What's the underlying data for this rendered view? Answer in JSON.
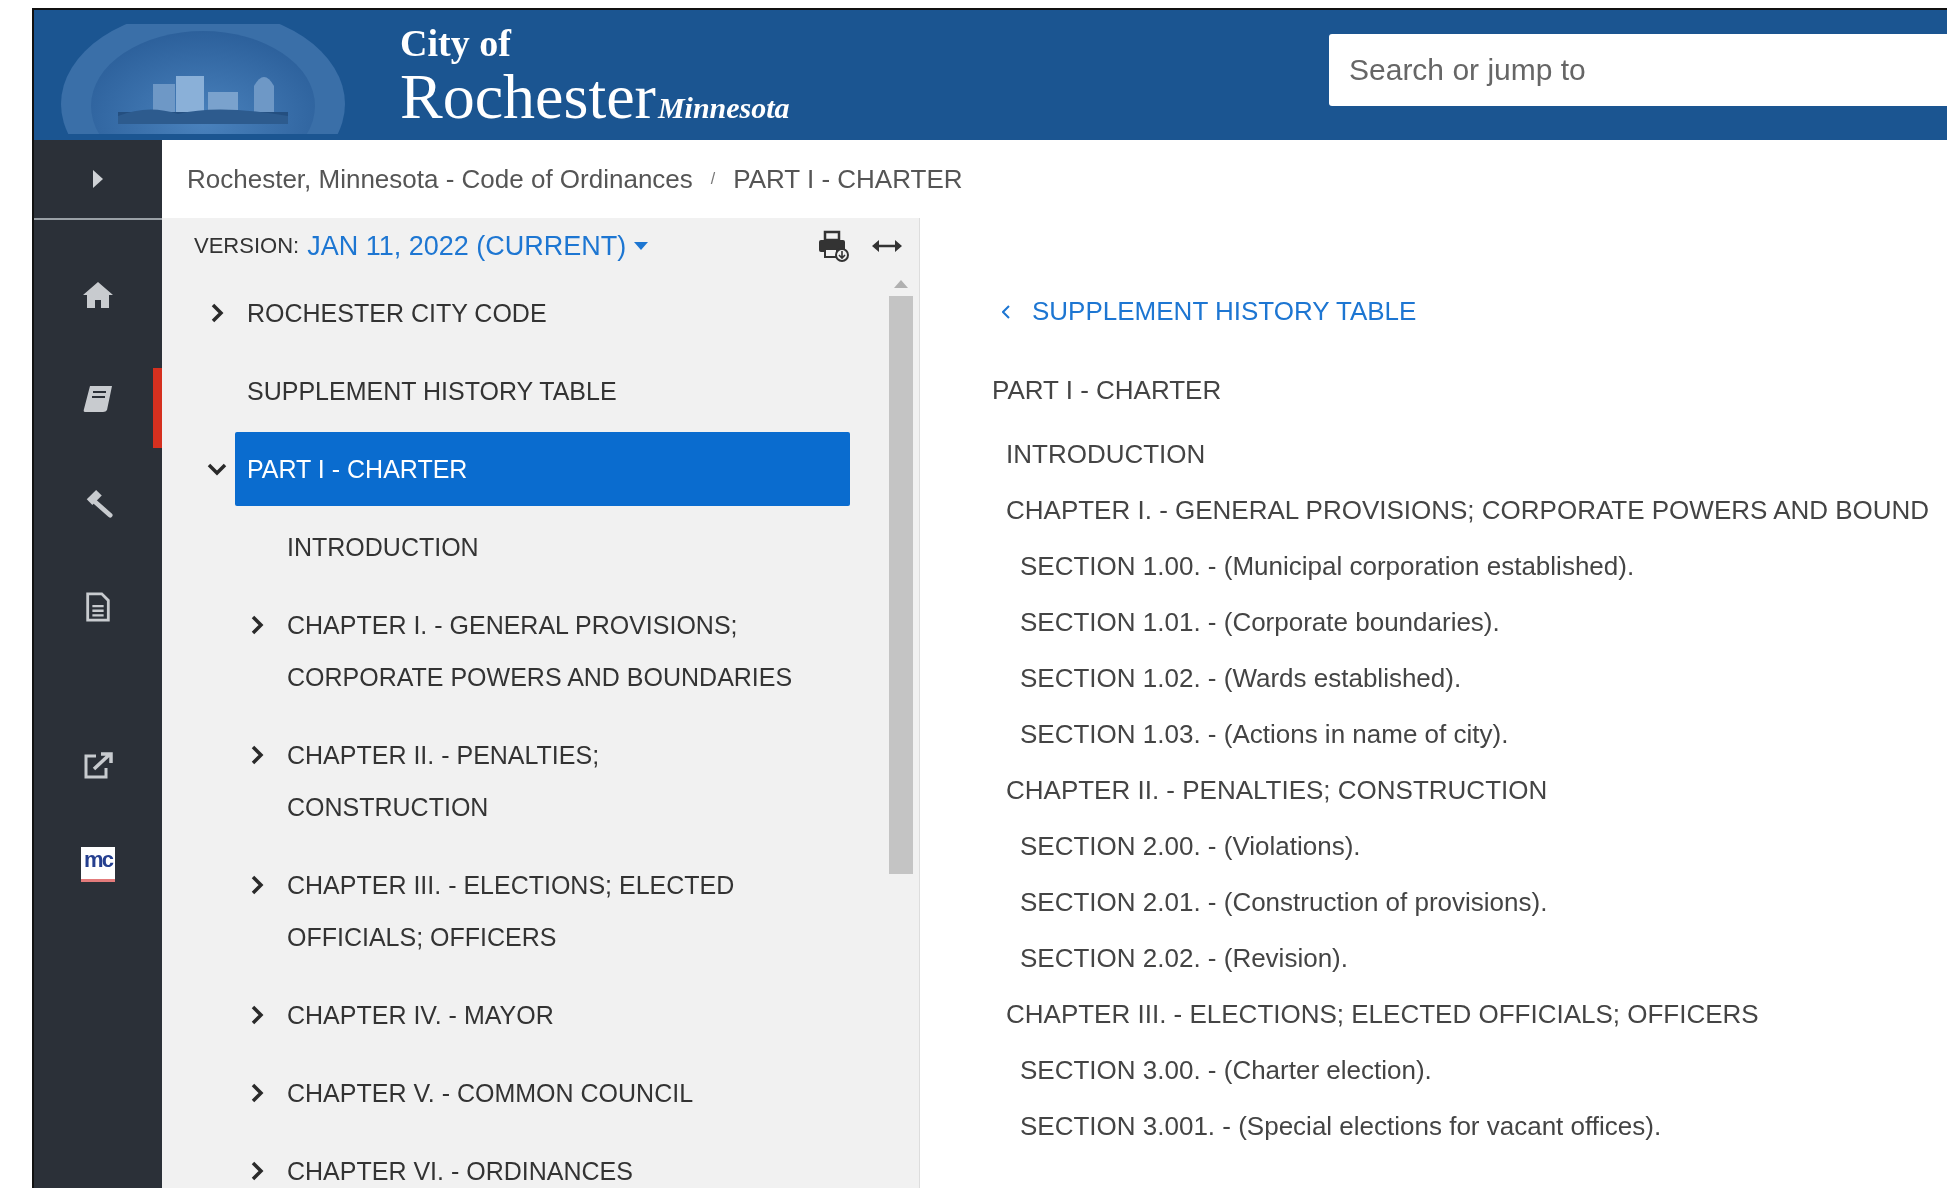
{
  "header": {
    "city_of": "City of",
    "name": "Rochester",
    "state": "Minnesota",
    "search": {
      "placeholder": "Search or jump to"
    }
  },
  "sidebar": {
    "items": [
      {
        "kind": "home",
        "selected": false
      },
      {
        "kind": "book",
        "selected": true
      },
      {
        "kind": "gavel",
        "selected": false
      },
      {
        "kind": "document",
        "selected": false
      },
      {
        "kind": "external",
        "selected": false
      },
      {
        "kind": "logo",
        "selected": false,
        "label": "mc"
      }
    ]
  },
  "breadcrumb": [
    "Rochester, Minnesota - Code of Ordinances",
    "PART I - CHARTER"
  ],
  "breadcrumb_separator": "/",
  "nav": {
    "version_label": "VERSION:",
    "version_value": "JAN 11, 2022 (CURRENT)",
    "items": [
      {
        "label": "ROCHESTER CITY CODE",
        "kind": "node",
        "expanded": false,
        "selected": false
      },
      {
        "label": "SUPPLEMENT HISTORY TABLE",
        "kind": "leaf",
        "selected": false
      },
      {
        "label": "PART I - CHARTER",
        "kind": "node",
        "expanded": true,
        "selected": true,
        "children": [
          {
            "label": "INTRODUCTION",
            "kind": "leaf",
            "selected": false
          },
          {
            "label": "CHAPTER I. - GENERAL PROVISIONS; CORPORATE POWERS AND BOUNDARIES",
            "kind": "node",
            "expanded": false,
            "selected": false
          },
          {
            "label": "CHAPTER II. - PENALTIES; CONSTRUCTION",
            "kind": "node",
            "expanded": false,
            "selected": false
          },
          {
            "label": "CHAPTER III. - ELECTIONS; ELECTED OFFICIALS; OFFICERS",
            "kind": "node",
            "expanded": false,
            "selected": false
          },
          {
            "label": "CHAPTER IV. - MAYOR",
            "kind": "node",
            "expanded": false,
            "selected": false
          },
          {
            "label": "CHAPTER V. - COMMON COUNCIL",
            "kind": "node",
            "expanded": false,
            "selected": false
          },
          {
            "label": "CHAPTER VI. - ORDINANCES",
            "kind": "node",
            "expanded": false,
            "selected": false
          }
        ]
      }
    ]
  },
  "content": {
    "back_link": "SUPPLEMENT HISTORY TABLE",
    "title": "PART I - CHARTER",
    "toc": [
      {
        "label": "INTRODUCTION"
      },
      {
        "label": "CHAPTER I. - GENERAL PROVISIONS; CORPORATE POWERS AND BOUND",
        "children": [
          {
            "label": "SECTION 1.00. - (Municipal corporation established)."
          },
          {
            "label": "SECTION 1.01. - (Corporate boundaries)."
          },
          {
            "label": "SECTION 1.02. - (Wards established)."
          },
          {
            "label": "SECTION 1.03. - (Actions in name of city)."
          }
        ]
      },
      {
        "label": "CHAPTER II. - PENALTIES; CONSTRUCTION",
        "children": [
          {
            "label": "SECTION 2.00. - (Violations)."
          },
          {
            "label": "SECTION 2.01. - (Construction of provisions)."
          },
          {
            "label": "SECTION 2.02. - (Revision)."
          }
        ]
      },
      {
        "label": "CHAPTER III. - ELECTIONS; ELECTED OFFICIALS; OFFICERS",
        "children": [
          {
            "label": "SECTION 3.00. - (Charter election)."
          },
          {
            "label": "SECTION 3.001. - (Special elections for vacant offices)."
          }
        ]
      }
    ]
  }
}
